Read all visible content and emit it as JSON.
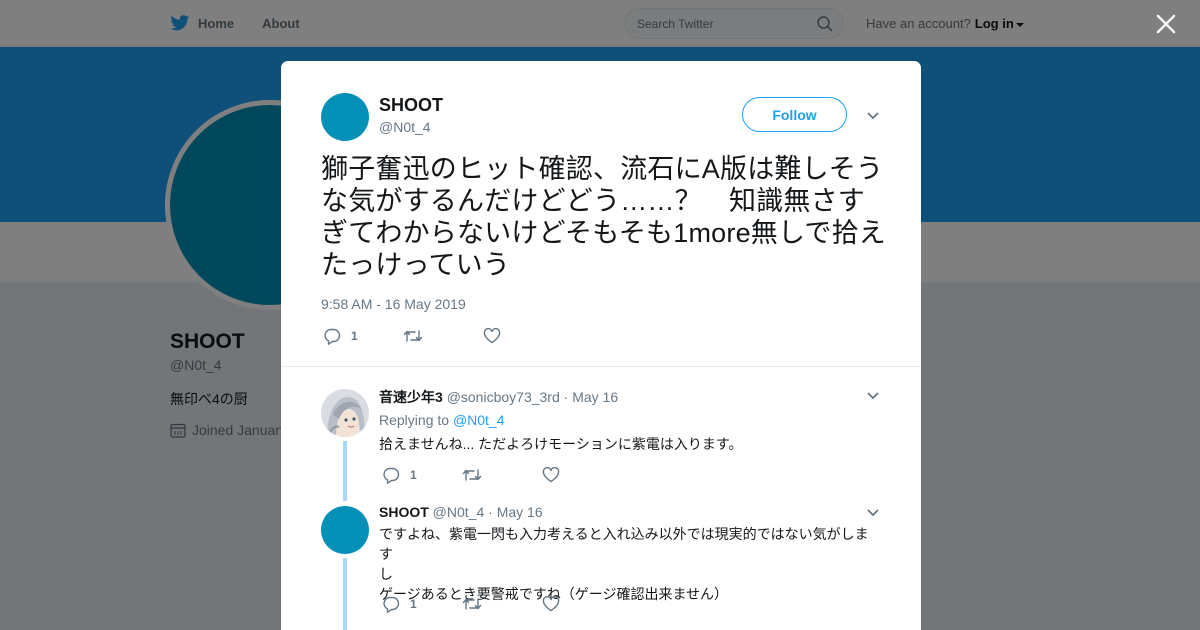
{
  "header": {
    "nav": [
      {
        "label": "Home",
        "icon": "twitter-bird-icon"
      },
      {
        "label": "About"
      }
    ],
    "search_placeholder": "Search Twitter",
    "account_prompt": "Have an account?",
    "login_label": "Log in"
  },
  "profile": {
    "name": "SHOOT",
    "handle": "@N0t_4",
    "bio": "無印べ4の厨",
    "joined": "Joined January"
  },
  "tweet": {
    "name": "SHOOT",
    "handle": "@N0t_4",
    "follow_label": "Follow",
    "text": "獅子奮迅のヒット確認、流石にA版は難しそうな気がするんだけどどう……？　知識無さすぎてわからないけどそもそも1more無しで拾えたっけっていう",
    "timestamp": "9:58 AM - 16 May 2019",
    "reply_count": "1",
    "retweet_count": "",
    "like_count": ""
  },
  "replies": [
    {
      "name": "音速少年3",
      "handle": "@sonicboy73_3rd",
      "date": "· May 16",
      "replying_prefix": "Replying to",
      "replying_to": "@N0t_4",
      "text": "拾えませんね... ただよろけモーションに紫電は入ります。",
      "reply_count": "1",
      "retweet_count": "",
      "like_count": ""
    },
    {
      "name": "SHOOT",
      "handle": "@N0t_4",
      "date": "· May 16",
      "text_lines": [
        "ですよね、紫電一閃も入力考えると入れ込み以外では現実的ではない気がします",
        "し",
        "ゲージあるとき要警戒ですね（ゲージ確認出来ません）"
      ],
      "reply_count": "1",
      "retweet_count": "",
      "like_count": ""
    }
  ],
  "colors": {
    "brand": "#1da1f2",
    "avatar": "#0590b8",
    "thread_line": "#a6d9f7",
    "secondary_text": "#657786"
  }
}
